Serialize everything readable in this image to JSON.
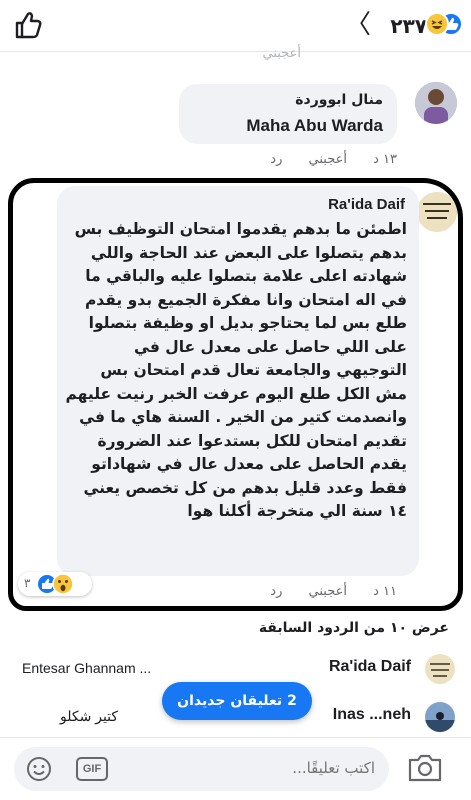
{
  "header": {
    "reaction_count": "٢٣٧",
    "back_icon": "chevron-left-icon",
    "like_icon": "thumbs-up-outline-icon"
  },
  "faded_prev_action": "أعجبني",
  "comments": [
    {
      "author": "منال ابووردة",
      "text": "Maha Abu Warda",
      "time": "١٣ د",
      "like_label": "أعجبني",
      "reply_label": "رد"
    },
    {
      "author": "Ra'ida Daif",
      "text": "اطمئن ما بدهم يقدموا امتحان التوظيف بس بدهم يتصلوا على البعض عند الحاجة واللي شهادته اعلى علامة بتصلوا عليه والباقي ما في اله امتحان  وانا مفكرة الجميع بدو يقدم طلع بس لما يحتاجو بديل او وظيفة بتصلوا على اللي حاصل على معدل عال في التوجيهي والجامعة تعال قدم امتحان بس مش الكل طلع اليوم عرفت الخبر رنيت عليهم وانصدمت كتير من الخير . السنة هاي ما في تقديم امتحان للكل بستدعوا  عند الضرورة يقدم الحاصل على معدل عال في شهاداتو فقط وعدد قليل بدهم من كل تخصص يعني ١٤ سنة الي متخرجة أكلنا هوا",
      "time": "١١ د",
      "like_label": "أعجبني",
      "reply_label": "رد",
      "reaction_count": "٣"
    }
  ],
  "view_previous": "عرض ١٠ من الردود السابقة",
  "replies": [
    {
      "author": "Ra'ida Daif",
      "preview": "Entesar Ghannam ..."
    },
    {
      "author": "Inas ...neh",
      "preview": "كتير شكلو"
    }
  ],
  "new_comments_pill": "2 تعليقان جديدان",
  "composer": {
    "placeholder": "اكتب تعليقًا...",
    "gif_label": "GIF"
  },
  "colors": {
    "facebook_blue": "#1877f2",
    "bubble_gray": "#f0f2f5",
    "meta_gray": "#65676b",
    "annotation_black": "#000000"
  }
}
